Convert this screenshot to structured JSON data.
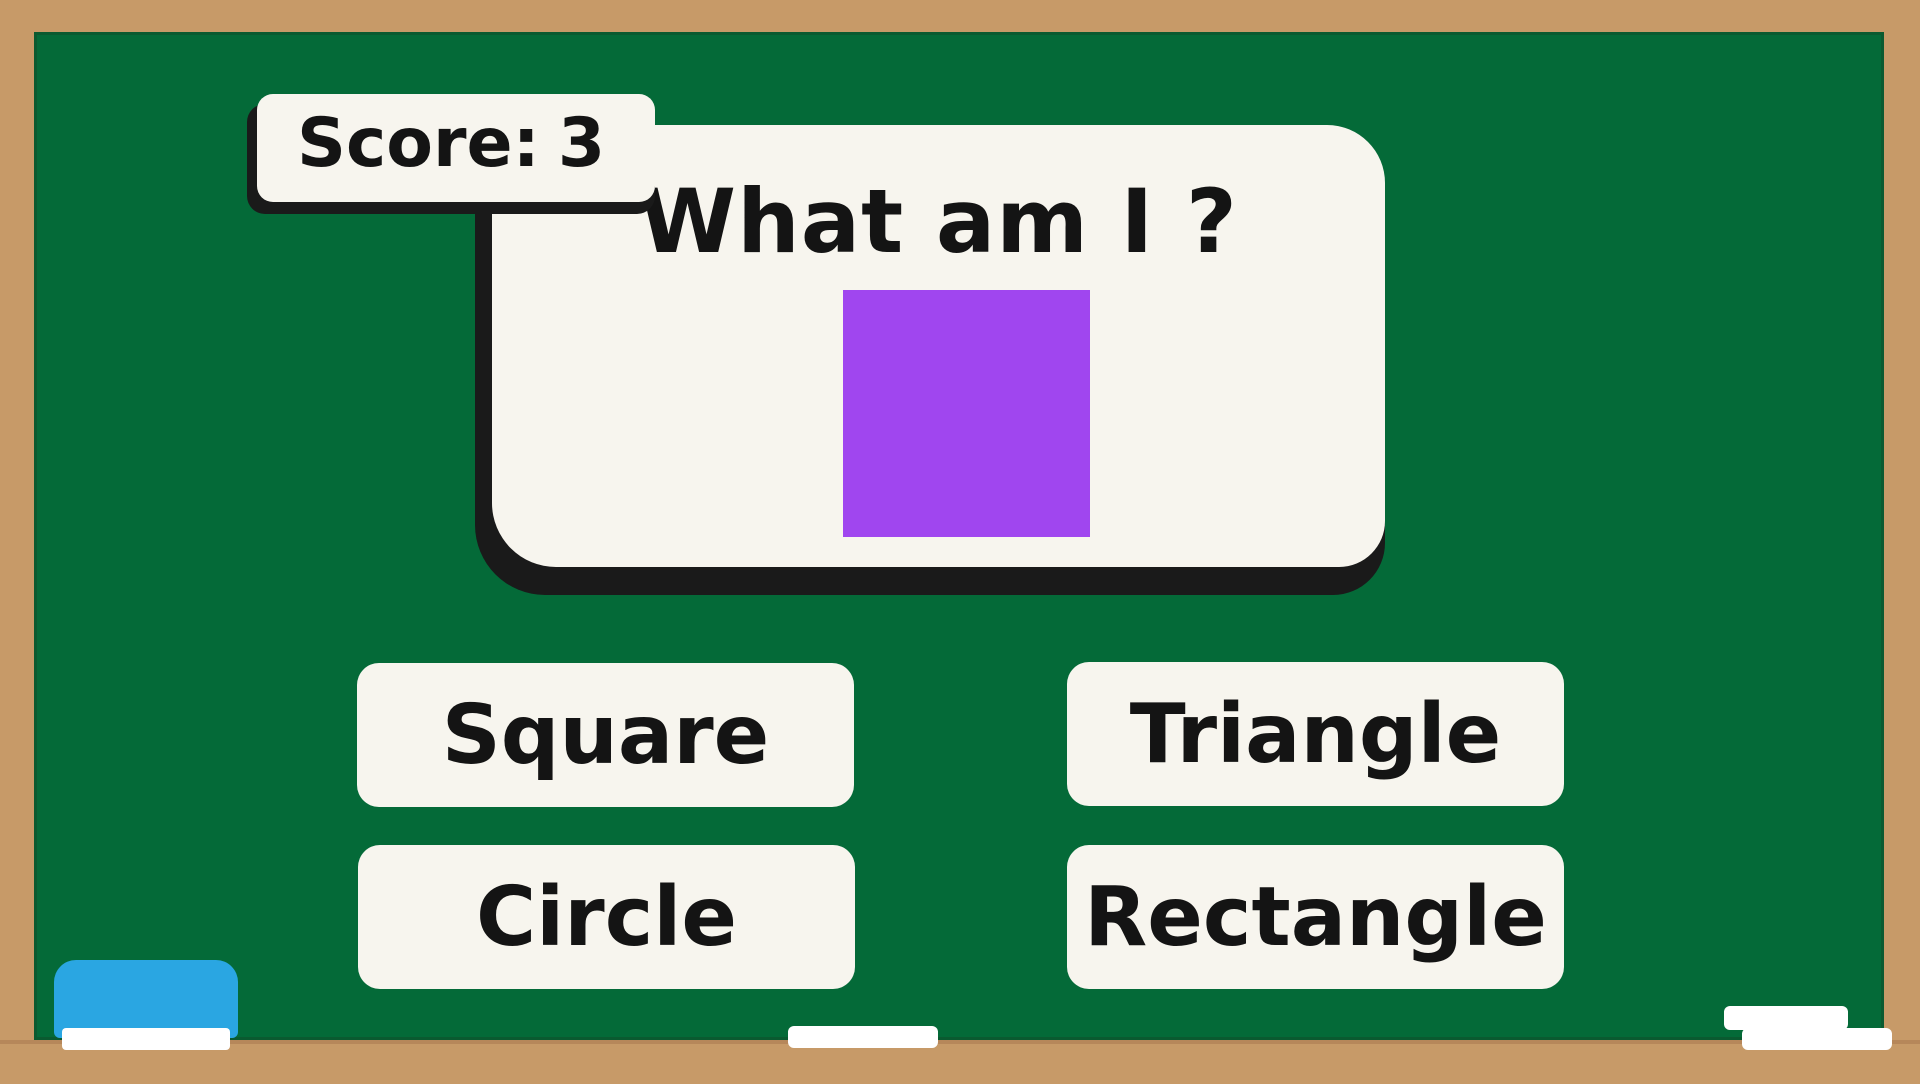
{
  "game": {
    "score_label": "Score:",
    "score_value": "3",
    "question": "What am I ?",
    "shape": {
      "name": "square",
      "color": "#a046ef"
    },
    "answers": [
      {
        "label": "Square"
      },
      {
        "label": "Triangle"
      },
      {
        "label": "Circle"
      },
      {
        "label": "Rectangle"
      }
    ]
  },
  "theme": {
    "board_color": "#046a38",
    "frame_color": "#c79a68",
    "card_color": "#f7f5ee",
    "eraser_color": "#2aa6e2",
    "chalk_color": "#ffffff"
  }
}
